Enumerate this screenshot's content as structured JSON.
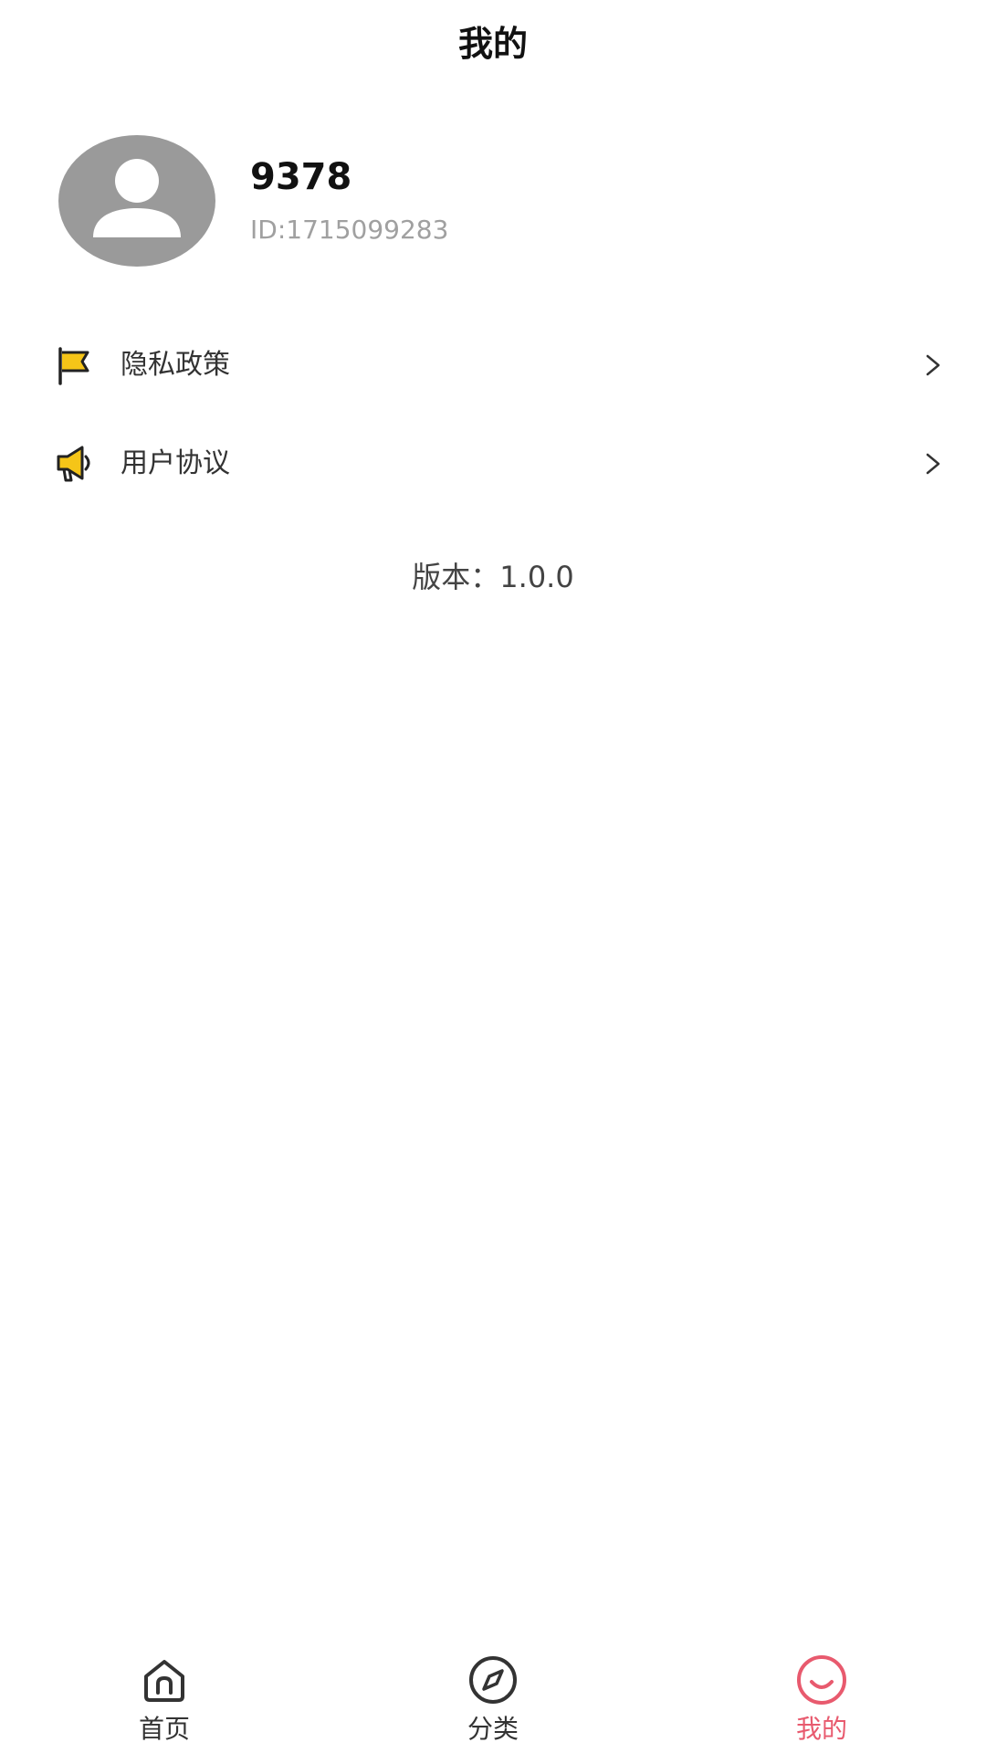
{
  "header": {
    "title": "我的"
  },
  "profile": {
    "username": "9378",
    "user_id": "ID:1715099283",
    "avatar_icon": "user-avatar-icon"
  },
  "menu": {
    "items": [
      {
        "label": "隐私政策",
        "icon": "flag-icon"
      },
      {
        "label": "用户协议",
        "icon": "megaphone-icon"
      }
    ]
  },
  "version": {
    "text": "版本：1.0.0"
  },
  "tabbar": {
    "tabs": [
      {
        "label": "首页",
        "icon": "home-icon",
        "active": false
      },
      {
        "label": "分类",
        "icon": "compass-icon",
        "active": false
      },
      {
        "label": "我的",
        "icon": "smile-icon",
        "active": true
      }
    ]
  },
  "colors": {
    "accent": "#e85a6e",
    "icon_yellow": "#f5c518",
    "avatar_gray": "#9a9a9a",
    "id_gray": "#a0a0a0"
  }
}
